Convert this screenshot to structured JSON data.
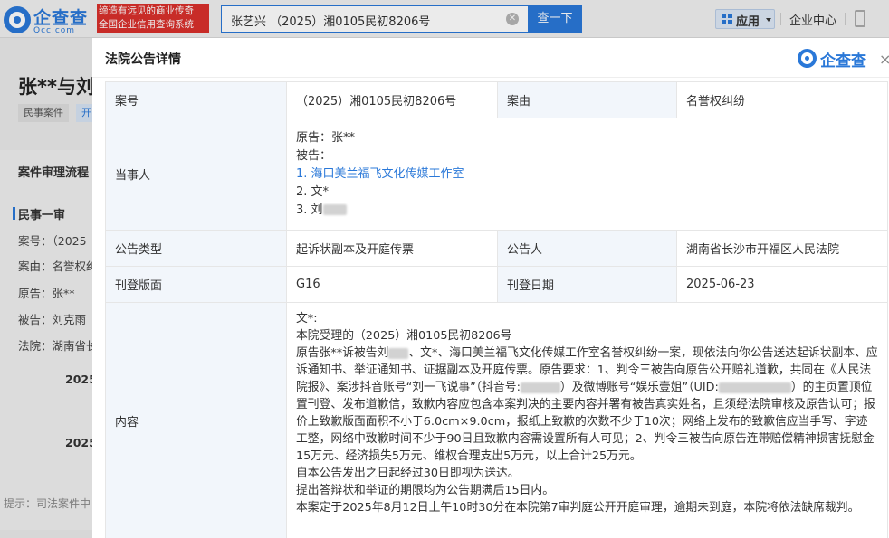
{
  "header": {
    "logo_text": "企查查",
    "logo_sub": "Qcc.com",
    "slogan_line1": "缔造有远见的商业传奇",
    "slogan_line2": "全国企业信用查询系统",
    "search_value": "张艺兴 （2025）湘0105民初8206号",
    "search_button": "查一下",
    "apps_label": "应用",
    "enterprise_link": "企业中心"
  },
  "background": {
    "title": "张**与刘",
    "tags": [
      "民事案件",
      "开"
    ],
    "flow_title": "案件审理流程",
    "sub_title": "民事一审",
    "rows": [
      "案号：（2025",
      "案由：名誉权纠",
      "原告：张**",
      "被告：刘克雨",
      "法院：湖南省长"
    ],
    "dates": [
      "2025",
      "2025"
    ],
    "tip": "提示：司法案件中"
  },
  "modal": {
    "title": "法院公告详情",
    "logo_text": "企查查",
    "close": "×",
    "case_no_label": "案号",
    "case_no": "（2025）湘0105民初8206号",
    "cause_label": "案由",
    "cause": "名誉权纠纷",
    "parties_label": "当事人",
    "plaintiff": "原告：张**",
    "defendant_label": "被告：",
    "defendants": [
      "1. 海口美兰福飞文化传媒工作室",
      "2. 文*",
      "3. 刘"
    ],
    "type_label": "公告类型",
    "type": "起诉状副本及开庭传票",
    "announcer_label": "公告人",
    "announcer": "湖南省长沙市开福区人民法院",
    "page_label": "刊登版面",
    "page": "G16",
    "date_label": "刊登日期",
    "date": "2025-06-23",
    "content_label": "内容",
    "content": {
      "line1": "文*:",
      "line2": "本院受理的（2025）湘0105民初8206号",
      "p1_a": "原告张**诉被告刘",
      "p1_b": "、文*、海口美兰福飞文化传媒工作室名誉权纠纷一案，现依法向你公告送达起诉状副本、应诉通知书、举证通知书、证据副本及开庭传票。原告要求：1、判令三被告向原告公开赔礼道歉，共同在《人民法院报》、案涉抖音账号“刘一飞说事”（抖音号:",
      "p1_c": "）及微博账号“娱乐壹姐”（UID:",
      "p1_d": "）的主页置顶位置刊登、发布道歉信，致歉内容应包含本案判决的主要内容并署有被告真实姓名，且须经法院审核及原告认可；报价上致歉版面面积不小于6.0cm×9.0cm，报纸上致歉的次数不少于10次；网络上发布的致歉信应当手写、字迹工整，网络中致歉时间不少于90日且致歉内容需设置所有人可见；2、判令三被告向原告连带赔偿精神损害抚慰金15万元、经济损失5万元、维权合理支出5万元，以上合计25万元。",
      "line4": "自本公告发出之日起经过30日即视为送达。",
      "line5": "提出答辩状和举证的期限均为公告期满后15日内。",
      "line6": "本案定于2025年8月12日上午10时30分在本院第7审判庭公开开庭审理，逾期未到庭，本院将依法缺席裁判。"
    }
  },
  "colors": {
    "brand": "#2a78d8",
    "slogan_bg": "#d9302c",
    "label_bg": "#f2f6fb"
  }
}
